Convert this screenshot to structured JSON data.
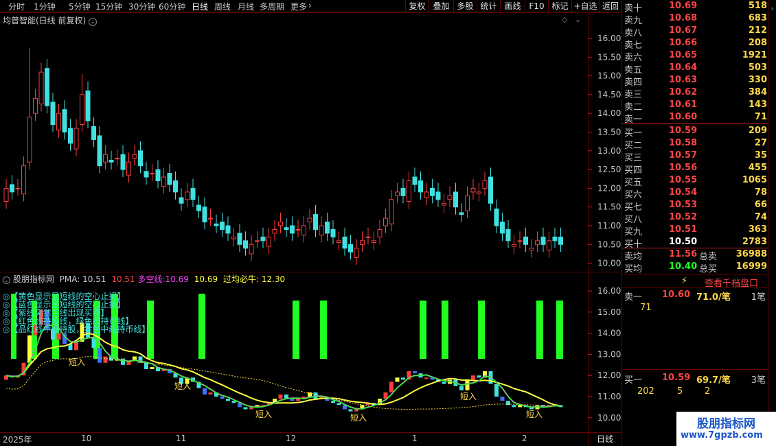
{
  "toolbar": {
    "periods": [
      "分时",
      "1分钟",
      "5分钟",
      "15分钟",
      "30分钟",
      "60分钟",
      "日线",
      "周线",
      "月线",
      "多周期",
      "更多"
    ],
    "active_period": "日线",
    "more_arrow": "chevron-right-icon",
    "buttons": [
      "复权",
      "叠加",
      "多股",
      "统计",
      "画线",
      "F10",
      "标记",
      "+自选",
      "返回"
    ]
  },
  "main_chart": {
    "title": "均普智能(日线 前复权)",
    "price_ticks": [
      "16.00",
      "15.50",
      "15.00",
      "14.50",
      "14.00",
      "13.50",
      "13.00",
      "12.50",
      "12.00",
      "11.50",
      "11.00",
      "10.50",
      "10.00"
    ]
  },
  "sub_chart": {
    "name": "股朋指标网",
    "pma_label": "PMA:",
    "pma_value": "10.51",
    "pma_value2": "10.51",
    "dkx_label": "多空线:",
    "dkx_value": "10.69",
    "dkx_value2": "10.69",
    "bull_label": "过均必牛:",
    "bull_value": "12.30",
    "ticks": [
      "16.00",
      "15.00",
      "14.00",
      "13.00",
      "12.00",
      "11.00",
      "10.00"
    ],
    "legend": [
      "【黄色显示是短线的空心止损】",
      "【蓝色显示是短线的空心止损】",
      "【紫线突然主线出现买卖】",
      "【红色线持股线，绿色线持币线】",
      "【品红线中线持股，黄色中线持币线】"
    ],
    "signal_label": "短入"
  },
  "date_axis": {
    "labels": [
      "2025年",
      "10",
      "11",
      "12",
      "1",
      "2"
    ],
    "period": "日线"
  },
  "orderbook": {
    "asks": [
      {
        "label": "卖十",
        "price": "10.69",
        "vol": "518"
      },
      {
        "label": "卖九",
        "price": "10.68",
        "vol": "683"
      },
      {
        "label": "卖八",
        "price": "10.67",
        "vol": "212"
      },
      {
        "label": "卖七",
        "price": "10.66",
        "vol": "208"
      },
      {
        "label": "卖六",
        "price": "10.65",
        "vol": "1921"
      },
      {
        "label": "卖五",
        "price": "10.64",
        "vol": "503"
      },
      {
        "label": "卖四",
        "price": "10.63",
        "vol": "330"
      },
      {
        "label": "卖三",
        "price": "10.62",
        "vol": "384"
      },
      {
        "label": "卖二",
        "price": "10.61",
        "vol": "143"
      },
      {
        "label": "卖一",
        "price": "10.60",
        "vol": "71"
      }
    ],
    "bids": [
      {
        "label": "买一",
        "price": "10.59",
        "vol": "209"
      },
      {
        "label": "买二",
        "price": "10.58",
        "vol": "27"
      },
      {
        "label": "买三",
        "price": "10.57",
        "vol": "35"
      },
      {
        "label": "买四",
        "price": "10.56",
        "vol": "455"
      },
      {
        "label": "买五",
        "price": "10.55",
        "vol": "1065"
      },
      {
        "label": "买六",
        "price": "10.54",
        "vol": "78"
      },
      {
        "label": "买七",
        "price": "10.53",
        "vol": "66"
      },
      {
        "label": "买八",
        "price": "10.52",
        "vol": "74"
      },
      {
        "label": "买九",
        "price": "10.51",
        "vol": "363"
      },
      {
        "label": "买十",
        "price": "10.50",
        "vol": "2783"
      }
    ],
    "avg_sell_label": "卖均",
    "avg_sell": "11.56",
    "total_sell_label": "总卖",
    "total_sell": "36988",
    "avg_buy_label": "买均",
    "avg_buy": "10.40",
    "total_buy_label": "总买",
    "total_buy": "16999",
    "thousand_label": "查看千档盘口",
    "ask1_label": "卖一",
    "ask1_price": "10.60",
    "ask1_per": "71.0/笔",
    "ask1_count": "1笔",
    "ask1_q": "71",
    "bid1_label": "买一",
    "bid1_price": "10.59",
    "bid1_per": "69.7/笔",
    "bid1_count": "3笔",
    "bid1_q1": "202",
    "bid1_q2": "5",
    "bid1_q3": "2"
  },
  "watermark": {
    "title": "股朋指标网",
    "url": "www.7gpzb.com"
  },
  "colors": {
    "up": "#ff3c3c",
    "down": "#40e0e0",
    "frame": "#6b0000",
    "signal": "#20ff20",
    "yellow": "#ffff40",
    "magenta": "#ff40ff"
  }
}
